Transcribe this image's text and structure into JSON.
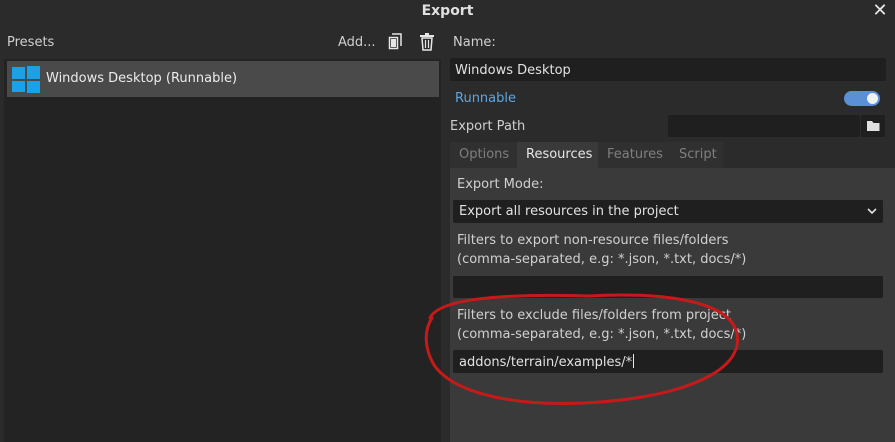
{
  "window": {
    "title": "Export"
  },
  "left": {
    "presets_label": "Presets",
    "add_label": "Add...",
    "presets": [
      {
        "label": "Windows Desktop (Runnable)"
      }
    ]
  },
  "right": {
    "name_label": "Name:",
    "name_value": "Windows Desktop",
    "runnable_label": "Runnable",
    "runnable_on": true,
    "export_path_label": "Export Path",
    "export_path_value": "",
    "tabs": [
      {
        "label": "Options"
      },
      {
        "label": "Resources"
      },
      {
        "label": "Features"
      },
      {
        "label": "Script"
      }
    ],
    "active_tab": "Resources",
    "export_mode_label": "Export Mode:",
    "export_mode_value": "Export all resources in the project",
    "include_filter_label_1": "Filters to export non-resource files/folders",
    "include_filter_label_2": "(comma-separated, e.g: *.json, *.txt, docs/*)",
    "include_filter_value": "",
    "exclude_filter_label_1": "Filters to exclude files/folders from project",
    "exclude_filter_label_2": "(comma-separated, e.g: *.json, *.txt, docs/*)",
    "exclude_filter_value": "addons/terrain/examples/*"
  },
  "colors": {
    "accent": "#5b8fd6",
    "annotation": "#c61a1a",
    "windows_logo": "#1aa1e6"
  }
}
